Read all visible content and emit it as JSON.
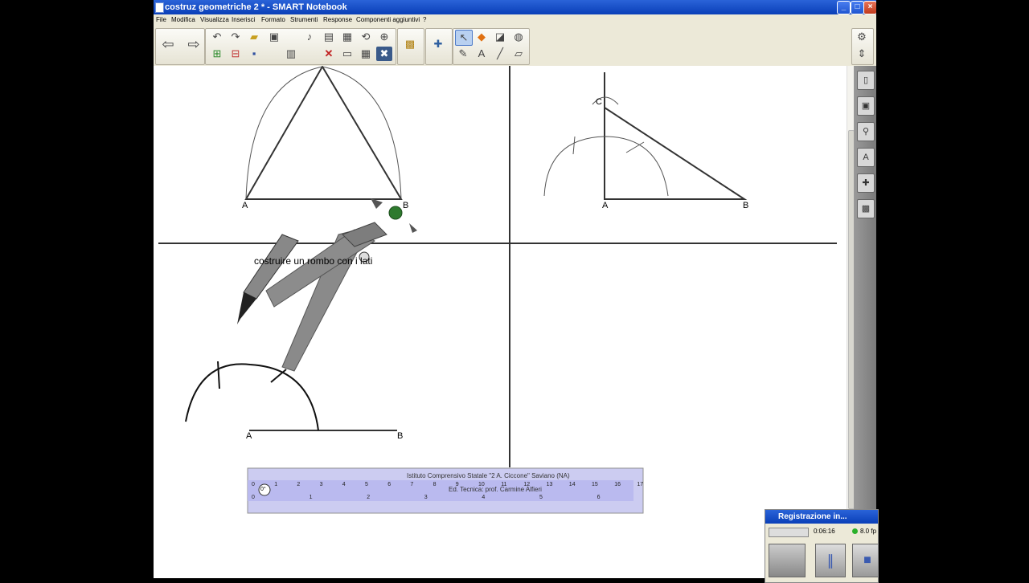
{
  "window": {
    "title": "costruz geometriche 2 * - SMART Notebook"
  },
  "menu": [
    "File",
    "Modifica",
    "Visualizza",
    "Inserisci",
    "Formato",
    "Strumenti",
    "Response",
    "Componenti aggiuntivi",
    "?"
  ],
  "toolbar": {
    "icons": [
      "back-arrow-icon",
      "forward-arrow-icon",
      "undo-icon",
      "redo-icon",
      "open-folder-icon",
      "screen-shade-icon",
      "audio-icon",
      "paste-icon",
      "screen-capture-icon",
      "rotate-icon",
      "zoom-icon",
      "new-page-icon",
      "delete-page-icon",
      "save-icon",
      "table-icon",
      "delete-icon",
      "display-icon",
      "insert-table-icon",
      "close-icon",
      "gallery-icon",
      "addons-icon",
      "select-icon",
      "shapes-icon",
      "eraser-icon",
      "fill-icon",
      "pens-icon",
      "text-icon",
      "line-icon",
      "shape-recognition-icon",
      "settings-icon",
      "toolbar-move-icon"
    ]
  },
  "canvas": {
    "labels": {
      "tl_A": "A",
      "tl_B": "B",
      "tr_A": "A",
      "tr_B": "B",
      "tr_C": "C",
      "bl_A": "A",
      "bl_B": "B"
    },
    "text_note": "costruire un rombo con i lati",
    "ruler": {
      "header": "Istituto Comprensivo Statale \"2 A. Ciccone\" Saviano (NA)",
      "subheader": "Ed. Tecnica: prof. Carmine Alfieri",
      "angle": "0°",
      "cm_ticks": [
        "0",
        "1",
        "2",
        "3",
        "4",
        "5",
        "6",
        "7",
        "8",
        "9",
        "10",
        "11",
        "12",
        "13",
        "14",
        "15",
        "16",
        "17"
      ],
      "inch_ticks": [
        "0",
        "1",
        "2",
        "3",
        "4",
        "5",
        "6"
      ]
    }
  },
  "recorder": {
    "title": "Registrazione in...",
    "time": "0:06:16",
    "fps": "8.0 fp"
  }
}
